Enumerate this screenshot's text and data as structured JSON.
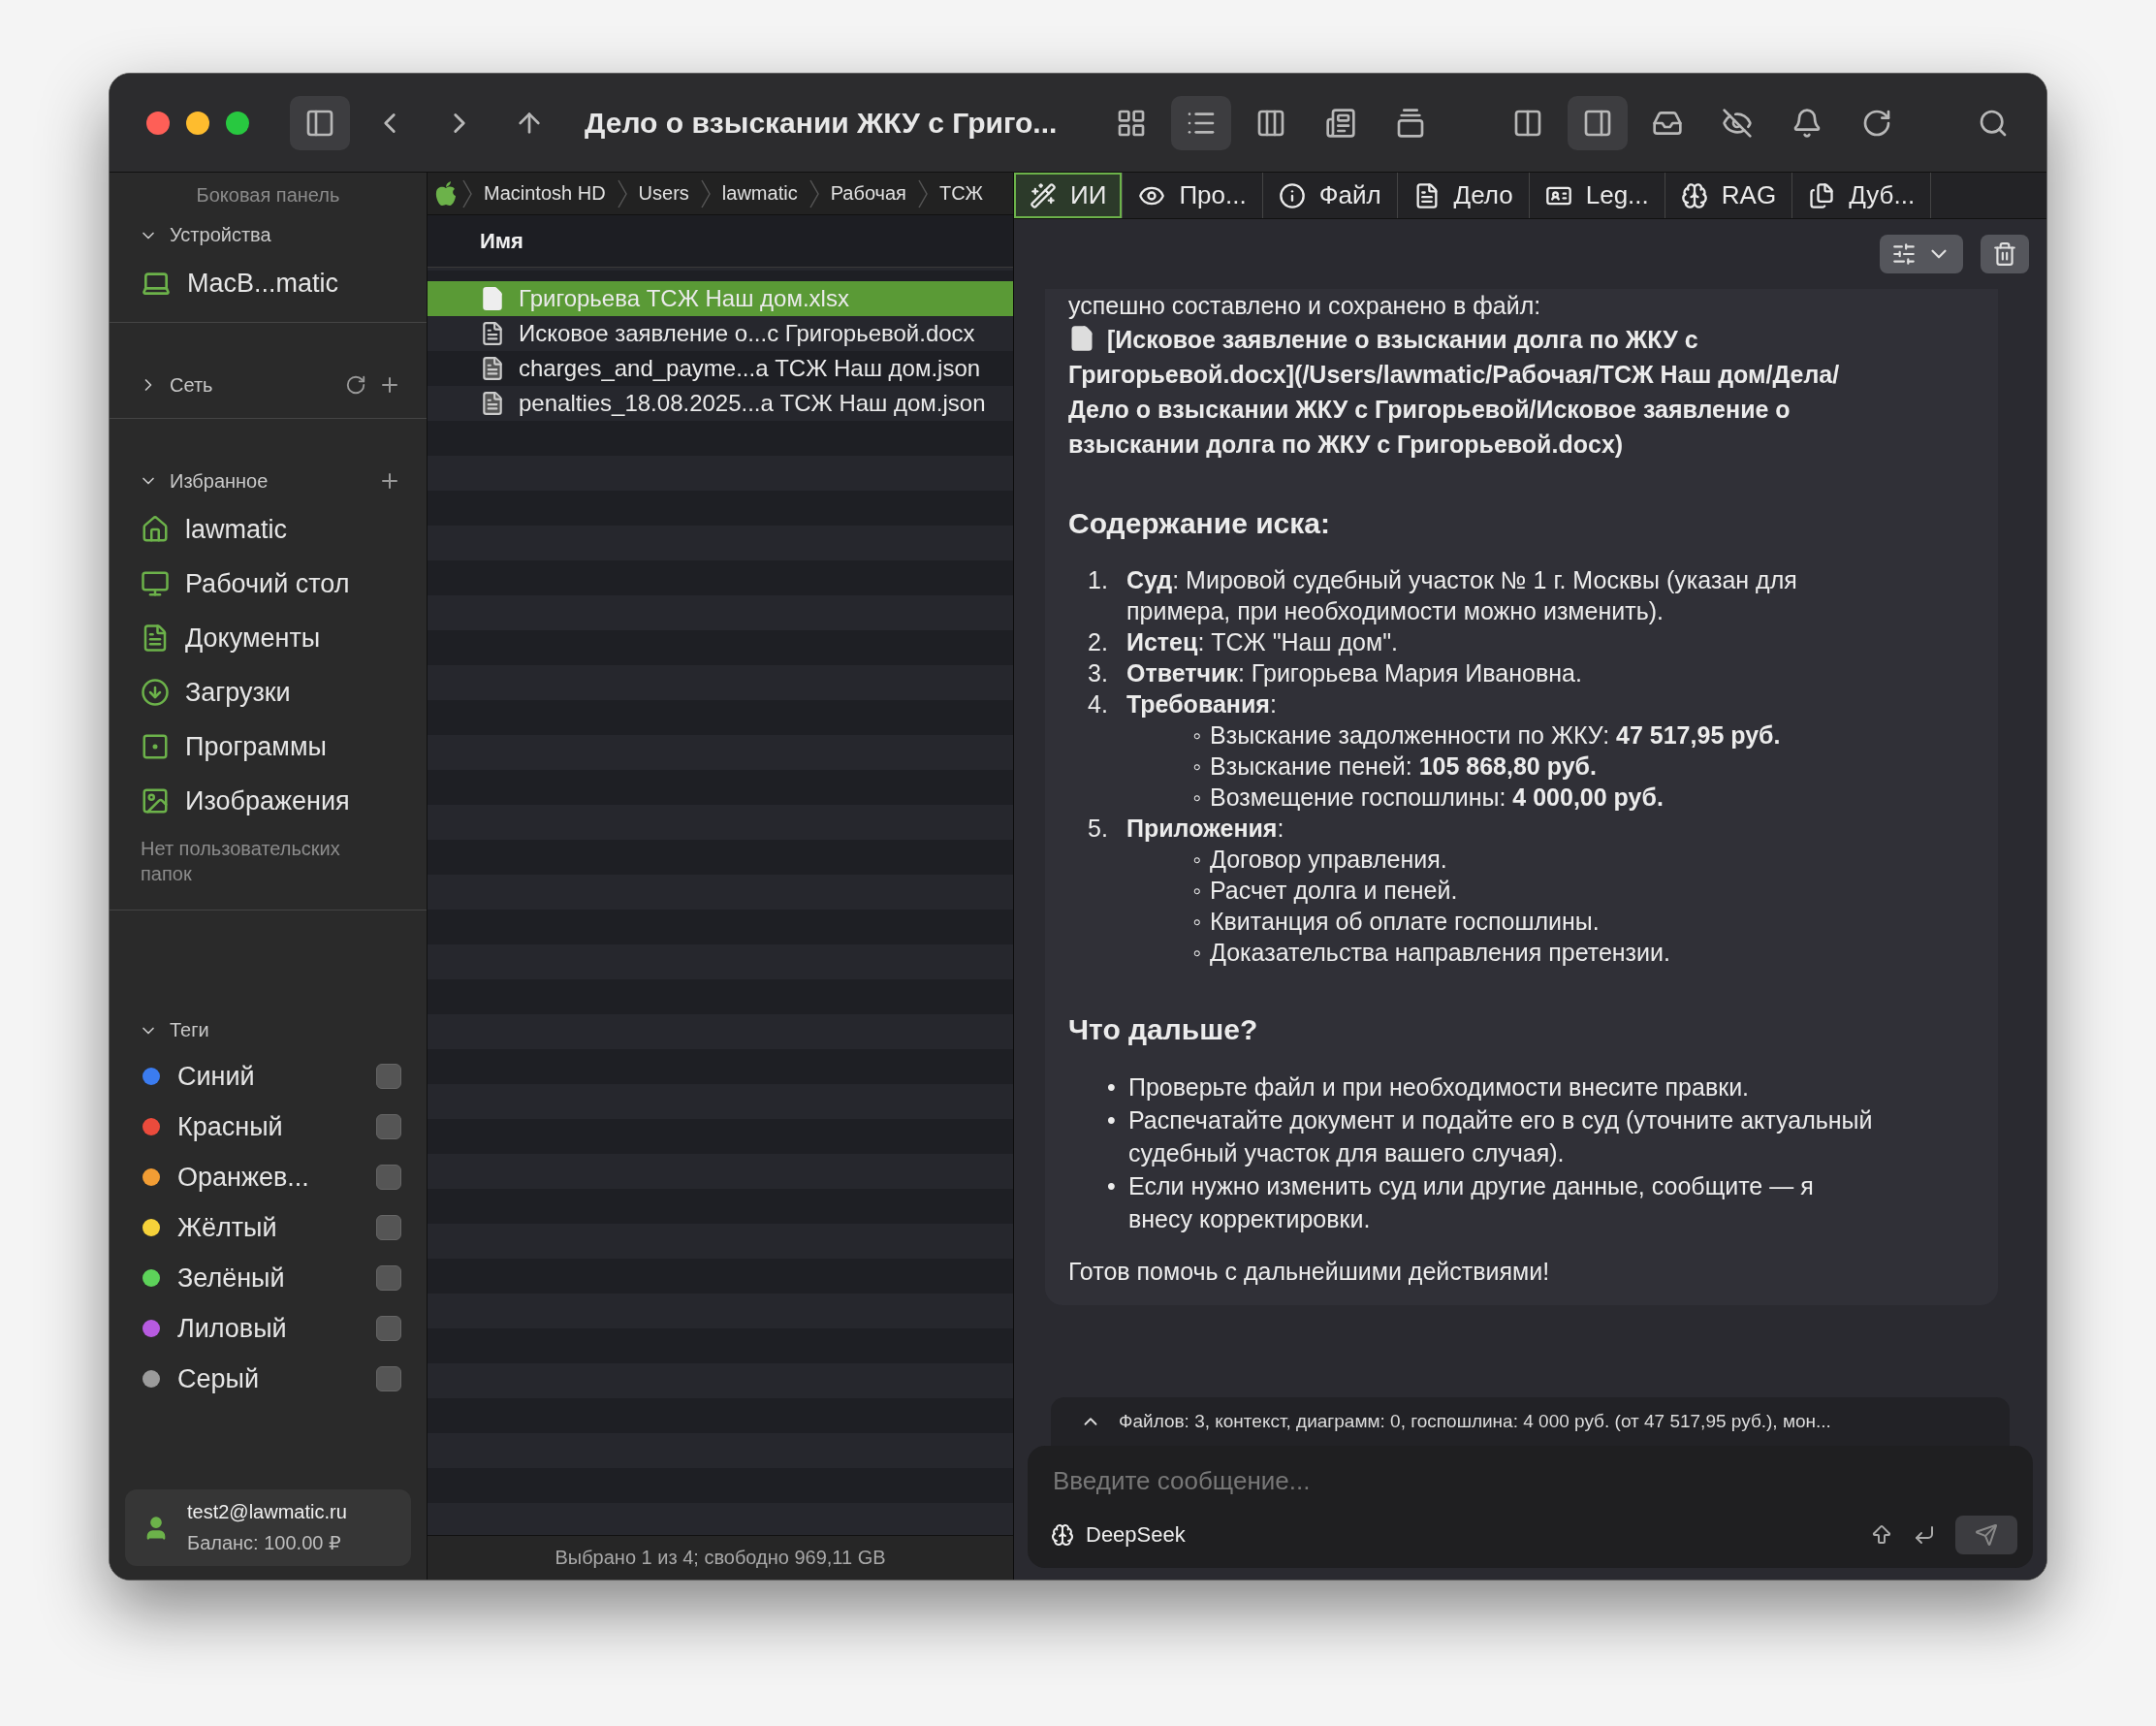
{
  "window": {
    "title": "Дело о взыскании ЖКУ с Григо..."
  },
  "toolbar": {
    "view_buttons": [
      {
        "selected": false
      },
      {
        "selected": true
      },
      {
        "selected": false
      },
      {
        "selected": false
      },
      {
        "selected": false
      }
    ],
    "panel_buttons": [
      {
        "selected": false
      },
      {
        "selected": true
      }
    ]
  },
  "sidebar": {
    "title": "Боковая панель",
    "devices": {
      "title": "Устройства",
      "expanded": true,
      "items": [
        "MacB...matic"
      ]
    },
    "network": {
      "title": "Сеть",
      "expanded": false
    },
    "favorites": {
      "title": "Избранное",
      "expanded": true,
      "items": [
        "lawmatic",
        "Рабочий стол",
        "Документы",
        "Загрузки",
        "Программы",
        "Изображения"
      ],
      "note": "Нет пользовательских папок"
    },
    "tags": {
      "title": "Теги",
      "expanded": true,
      "items": [
        {
          "label": "Синий",
          "color": "#3b7cf0",
          "checked": false
        },
        {
          "label": "Красный",
          "color": "#eb4b3c",
          "checked": false
        },
        {
          "label": "Оранжев...",
          "color": "#f29d34",
          "checked": false
        },
        {
          "label": "Жёлтый",
          "color": "#f6d23a",
          "checked": false
        },
        {
          "label": "Зелёный",
          "color": "#5dd25a",
          "checked": false
        },
        {
          "label": "Лиловый",
          "color": "#b75be0",
          "checked": false
        },
        {
          "label": "Серый",
          "color": "#9b9b9b",
          "checked": false
        }
      ]
    },
    "account": {
      "email": "test2@lawmatic.ru",
      "balance": "Баланс: 100.00 ₽"
    }
  },
  "files": {
    "path": [
      "Macintosh HD",
      "Users",
      "lawmatic",
      "Рабочая",
      "ТСЖ"
    ],
    "column": "Имя",
    "rows": [
      {
        "name": "Григорьева ТСЖ Наш дом.xlsx",
        "kind": "sheet",
        "selected": true
      },
      {
        "name": "Исковое заявление о...с Григорьевой.docx",
        "kind": "doc",
        "selected": false
      },
      {
        "name": "charges_and_payme...а ТСЖ Наш дом.json",
        "kind": "data",
        "selected": false
      },
      {
        "name": "penalties_18.08.2025...а ТСЖ Наш дом.json",
        "kind": "data",
        "selected": false
      }
    ],
    "status": "Выбрано 1 из 4; свободно 969,11 GB"
  },
  "chat": {
    "tabs": [
      {
        "label": "ИИ",
        "selected": true
      },
      {
        "label": "Про...",
        "selected": false
      },
      {
        "label": "Файл",
        "selected": false
      },
      {
        "label": "Дело",
        "selected": false
      },
      {
        "label": "Leg...",
        "selected": false
      },
      {
        "label": "RAG",
        "selected": false
      },
      {
        "label": "Дуб...",
        "selected": false
      }
    ],
    "message": [
      {
        "kind": "paragraph",
        "text": "успешно составлено и сохранено в файл:"
      },
      {
        "kind": "file_link",
        "text": "[Исковое заявление о взыскании долга по ЖКУ с Григорьевой.docx](/Users/lawmatic/Рабочая/ТСЖ Наш дом/Дела/Дело о взыскании ЖКУ с Григорьевой/Исковое заявление о взыскании долга по ЖКУ с Григорьевой.docx)"
      },
      {
        "kind": "heading",
        "text": "Содержание иска:"
      },
      {
        "kind": "ordered",
        "items": [
          {
            "marker": "1.",
            "text": "**Суд**: Мировой судебный участок № 1 г. Москвы (указан для примера, при необходимости можно изменить)."
          },
          {
            "marker": "2.",
            "text": "**Истец**: ТСЖ \"Наш дом\"."
          },
          {
            "marker": "3.",
            "text": "**Ответчик**: Григорьева Мария Ивановна."
          },
          {
            "marker": "4.",
            "text": "**Требования**:",
            "children": [
              {
                "marker": "◦",
                "text": "Взыскание задолженности по ЖКУ: **47 517,95 руб.**"
              },
              {
                "marker": "◦",
                "text": "Взыскание пеней: **105 868,80 руб.**"
              },
              {
                "marker": "◦",
                "text": "Возмещение госпошлины: **4 000,00 руб.**"
              }
            ]
          },
          {
            "marker": "5.",
            "text": "**Приложения**:",
            "children": [
              {
                "marker": "◦",
                "text": "Договор управления."
              },
              {
                "marker": "◦",
                "text": "Расчет долга и пеней."
              },
              {
                "marker": "◦",
                "text": "Квитанция об оплате госпошлины."
              },
              {
                "marker": "◦",
                "text": "Доказательства направления претензии."
              }
            ]
          }
        ]
      },
      {
        "kind": "heading",
        "text": "Что дальше?"
      },
      {
        "kind": "bullets",
        "items": [
          {
            "marker": "•",
            "text": "Проверьте файл и при необходимости внесите правки."
          },
          {
            "marker": "•",
            "text": "Распечатайте документ и подайте его в суд (уточните актуальный судебный участок для вашего случая)."
          },
          {
            "marker": "•",
            "text": "Если нужно изменить суд или другие данные, сообщите — я внесу корректировки."
          }
        ]
      },
      {
        "kind": "paragraph",
        "text": "Готов помочь с дальнейшими действиями!"
      }
    ],
    "context": "Файлов: 3, контекст, диаграмм: 0, госпошлина: 4 000 руб. (от 47 517,95 руб.), мон...",
    "input": {
      "placeholder": "Введите сообщение..."
    },
    "model": "DeepSeek"
  }
}
